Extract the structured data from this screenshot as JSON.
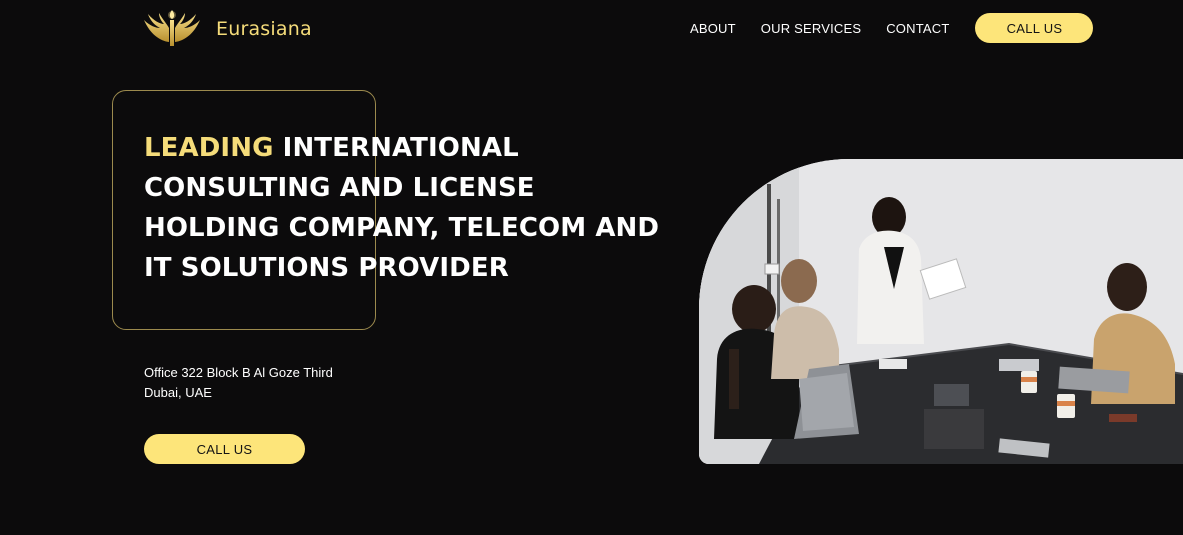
{
  "brand": {
    "name": "Eurasiana",
    "logo_icon": "winged-torch-logo",
    "accent_color": "#f5dc7a"
  },
  "nav": {
    "items": [
      "ABOUT",
      "OUR SERVICES",
      "CONTACT"
    ],
    "cta_label": "CALL US"
  },
  "hero": {
    "headline_accent": "LEADING",
    "headline_rest": " INTERNATIONAL CONSULTING AND LICENSE HOLDING COMPANY, TELECOM AND IT SOLUTIONS PROVIDER",
    "address_line1": "Office 322 Block B Al Goze Third",
    "address_line2": "Dubai, UAE",
    "cta_label": "CALL US",
    "image": "business-meeting-photo"
  },
  "colors": {
    "background": "#0c0b0c",
    "button": "#fde57a"
  }
}
